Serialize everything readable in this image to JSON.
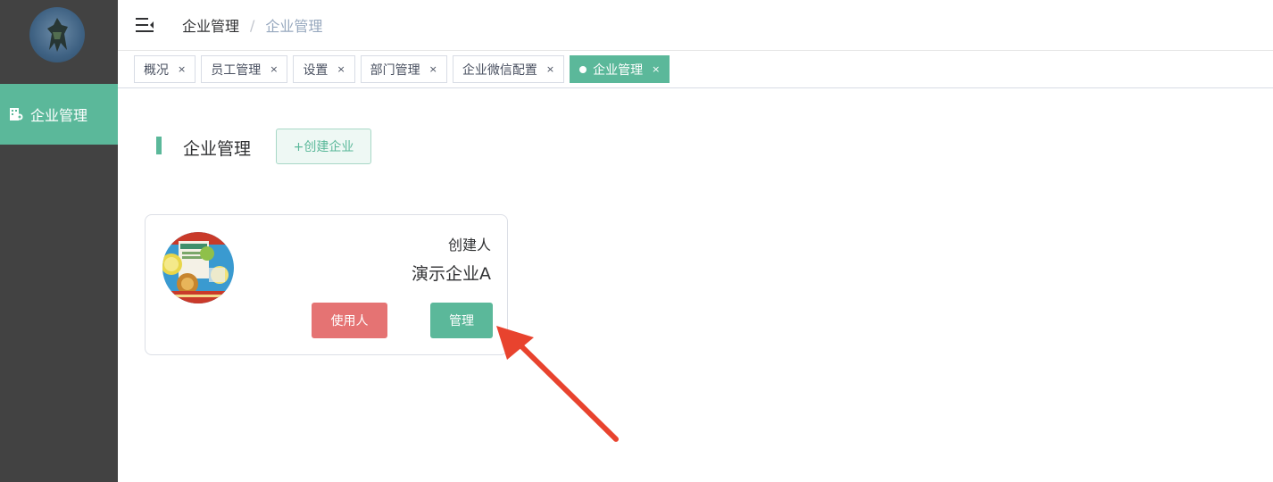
{
  "sidebar": {
    "menu": [
      {
        "label": "企业管理",
        "icon": "building-icon",
        "active": true
      }
    ]
  },
  "header": {
    "breadcrumb": [
      "企业管理",
      "企业管理"
    ],
    "separator": "/"
  },
  "tabs": [
    {
      "label": "概况",
      "close": "×"
    },
    {
      "label": "员工管理",
      "close": "×"
    },
    {
      "label": "设置",
      "close": "×"
    },
    {
      "label": "部门管理",
      "close": "×"
    },
    {
      "label": "企业微信配置",
      "close": "×"
    },
    {
      "label": "企业管理",
      "close": "×",
      "active": true
    }
  ],
  "page": {
    "title": "企业管理",
    "create_button": "+创建企业"
  },
  "card": {
    "creator_label": "创建人",
    "company_name": "演示企业A",
    "users_button": "使用人",
    "manage_button": "管理"
  },
  "colors": {
    "accent": "#5bb89a",
    "danger": "#e57373",
    "sidebar": "#424242",
    "arrow": "#e8432e"
  }
}
